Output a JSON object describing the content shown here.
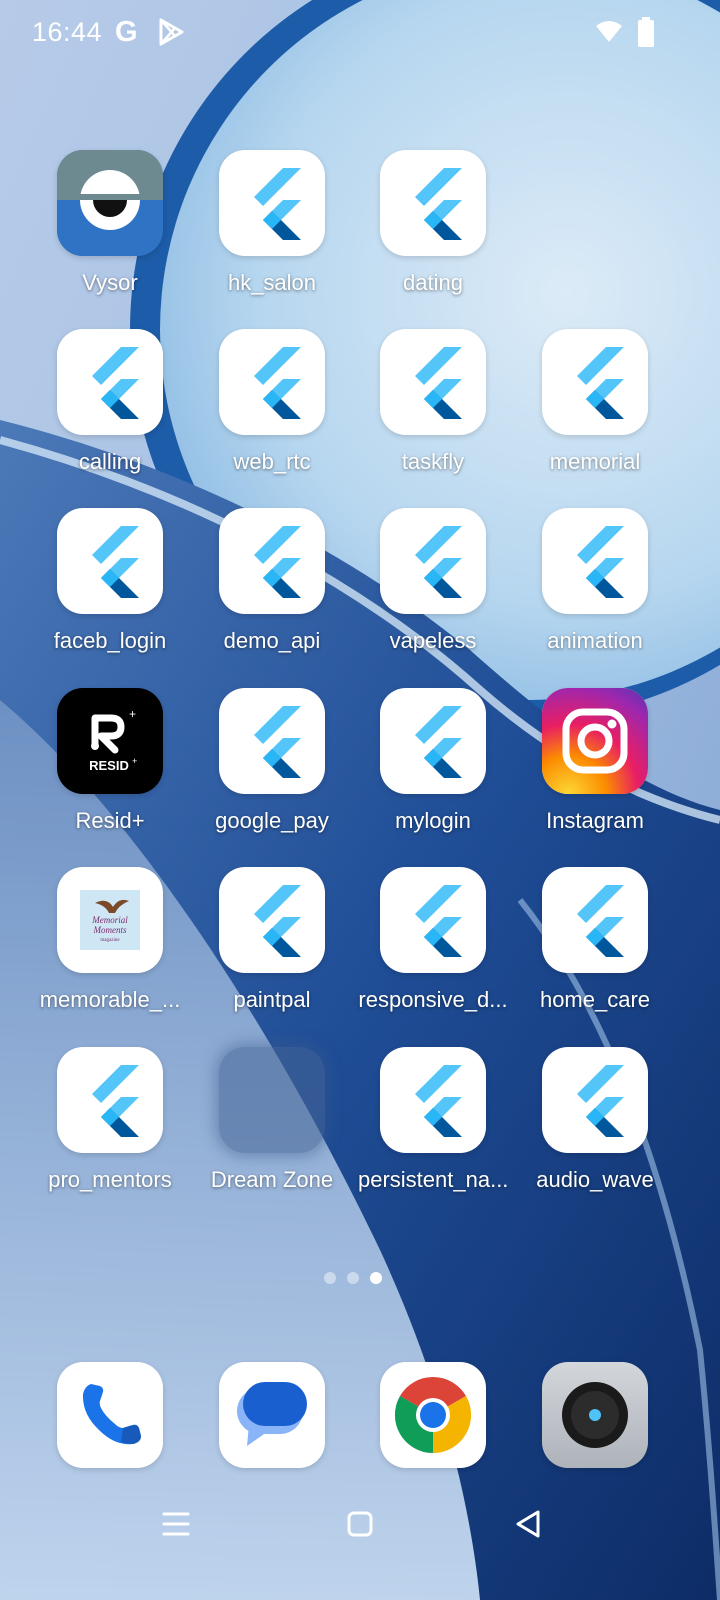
{
  "status_bar": {
    "time": "16:44",
    "google_badge": "G",
    "icons": [
      "google-icon",
      "play-store-icon",
      "wifi-icon",
      "battery-icon"
    ]
  },
  "apps": [
    {
      "label": "Vysor",
      "icon": "vysor-icon"
    },
    {
      "label": "hk_salon",
      "icon": "flutter-icon"
    },
    {
      "label": "dating",
      "icon": "flutter-icon"
    },
    {
      "label": "calling",
      "icon": "flutter-icon"
    },
    {
      "label": "web_rtc",
      "icon": "flutter-icon"
    },
    {
      "label": "taskfly",
      "icon": "flutter-icon"
    },
    {
      "label": "memorial",
      "icon": "flutter-icon"
    },
    {
      "label": "faceb_login",
      "icon": "flutter-icon"
    },
    {
      "label": "demo_api",
      "icon": "flutter-icon"
    },
    {
      "label": "vapeless",
      "icon": "flutter-icon"
    },
    {
      "label": "animation",
      "icon": "flutter-icon"
    },
    {
      "label": "Resid+",
      "icon": "resid-icon",
      "icon_text": "RESID"
    },
    {
      "label": "google_pay",
      "icon": "flutter-icon"
    },
    {
      "label": "mylogin",
      "icon": "flutter-icon"
    },
    {
      "label": "Instagram",
      "icon": "instagram-icon"
    },
    {
      "label": "memorable_...",
      "icon": "memorial-moments-icon",
      "icon_text_1": "Memorial",
      "icon_text_2": "Moments",
      "icon_text_3": "magazine"
    },
    {
      "label": "paintpal",
      "icon": "flutter-icon"
    },
    {
      "label": "responsive_d...",
      "icon": "flutter-icon"
    },
    {
      "label": "home_care",
      "icon": "flutter-icon"
    },
    {
      "label": "pro_mentors",
      "icon": "flutter-icon"
    },
    {
      "label": "Dream Zone",
      "icon": "folder-icon"
    },
    {
      "label": "persistent_na...",
      "icon": "flutter-icon"
    },
    {
      "label": "audio_wave",
      "icon": "flutter-icon"
    }
  ],
  "page_indicator": {
    "pages": 3,
    "current": 3
  },
  "dock": [
    {
      "name": "phone",
      "icon": "phone-icon"
    },
    {
      "name": "messages",
      "icon": "messages-icon"
    },
    {
      "name": "chrome",
      "icon": "chrome-icon"
    },
    {
      "name": "camera",
      "icon": "camera-icon"
    }
  ],
  "nav_bar": [
    "menu-icon",
    "home-icon",
    "back-icon"
  ],
  "colors": {
    "flutter_light": "#54c5f8",
    "flutter_dark": "#01579b",
    "flutter_mid": "#29b6f6",
    "wallpaper_blue": "#1e4f9c"
  }
}
